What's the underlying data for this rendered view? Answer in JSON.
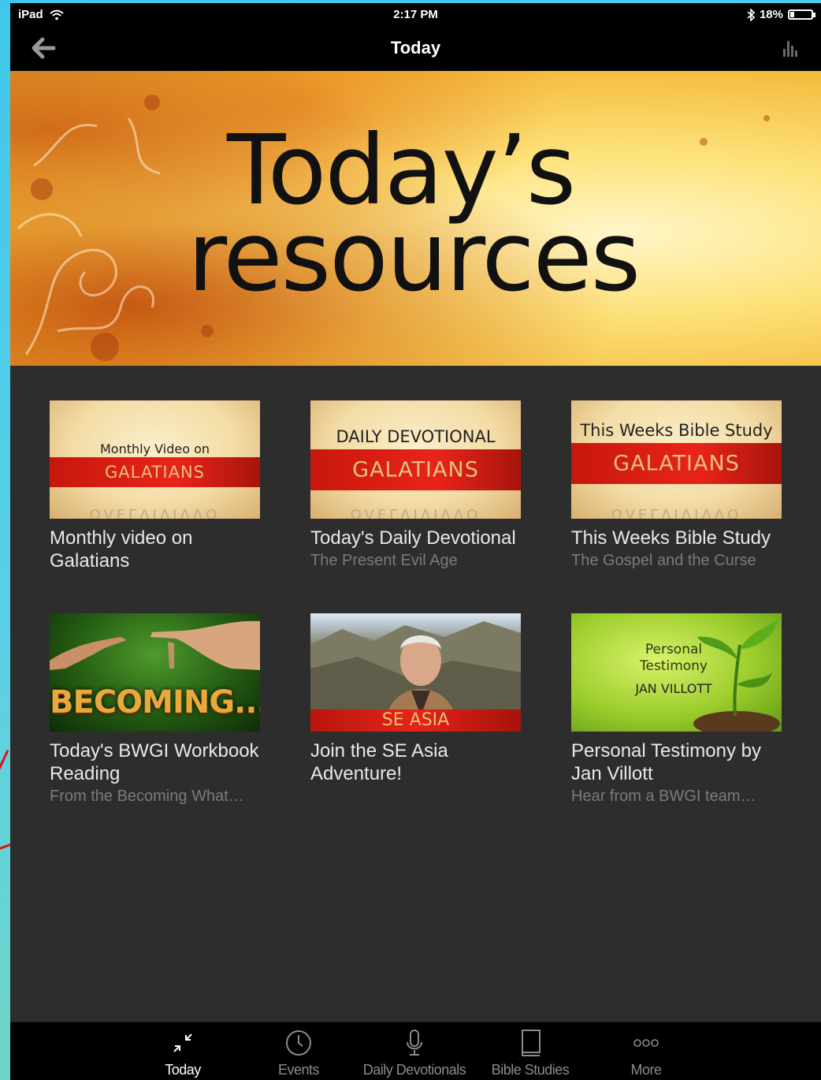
{
  "status_bar": {
    "device": "iPad",
    "time": "2:17 PM",
    "battery": "18%",
    "battery_level": 0.18
  },
  "nav": {
    "title": "Today"
  },
  "hero": {
    "line1": "Today’s",
    "line2": "resources"
  },
  "tiles": [
    {
      "title": "Monthly video on Galatians",
      "subtitle": "",
      "thumb": {
        "top": "Monthly Video on",
        "band": "GALATIANS",
        "ghost": "ΩVΕΓΛΙΛΙΛΛΟ"
      }
    },
    {
      "title": "Today's Daily Devotional",
      "subtitle": "The Present Evil Age",
      "thumb": {
        "top": "DAILY DEVOTIONAL",
        "band": "GALATIANS",
        "ghost": "ΩVΕΓΛΙΛΙΛΛΟ"
      }
    },
    {
      "title": "This Weeks Bible Study",
      "subtitle": "The Gospel and the Curse",
      "thumb": {
        "top": "This Weeks Bible Study",
        "band": "GALATIANS",
        "ghost": "ΩVΕΓΛΙΛΙΛΛΟ"
      }
    },
    {
      "title": "Today's BWGI Workbook Reading",
      "subtitle": "From the Becoming What…",
      "thumb": {
        "text": "BECOMING..."
      }
    },
    {
      "title": "Join the SE Asia Adventure!",
      "subtitle": "",
      "thumb": {
        "text": "SE ASIA"
      }
    },
    {
      "title": "Personal Testimony by Jan Villott",
      "subtitle": "Hear from a BWGI team…",
      "thumb": {
        "text": "Personal Testimony",
        "name": "JAN VILLOTT"
      }
    }
  ],
  "tab_bar": {
    "items": [
      {
        "label": "Today",
        "icon": "collapse-arrows-icon",
        "active": true
      },
      {
        "label": "Events",
        "icon": "clock-icon",
        "active": false
      },
      {
        "label": "Daily Devotionals",
        "icon": "microphone-icon",
        "active": false
      },
      {
        "label": "Bible Studies",
        "icon": "book-icon",
        "active": false
      },
      {
        "label": "More",
        "icon": "more-dots-icon",
        "active": false
      }
    ]
  }
}
